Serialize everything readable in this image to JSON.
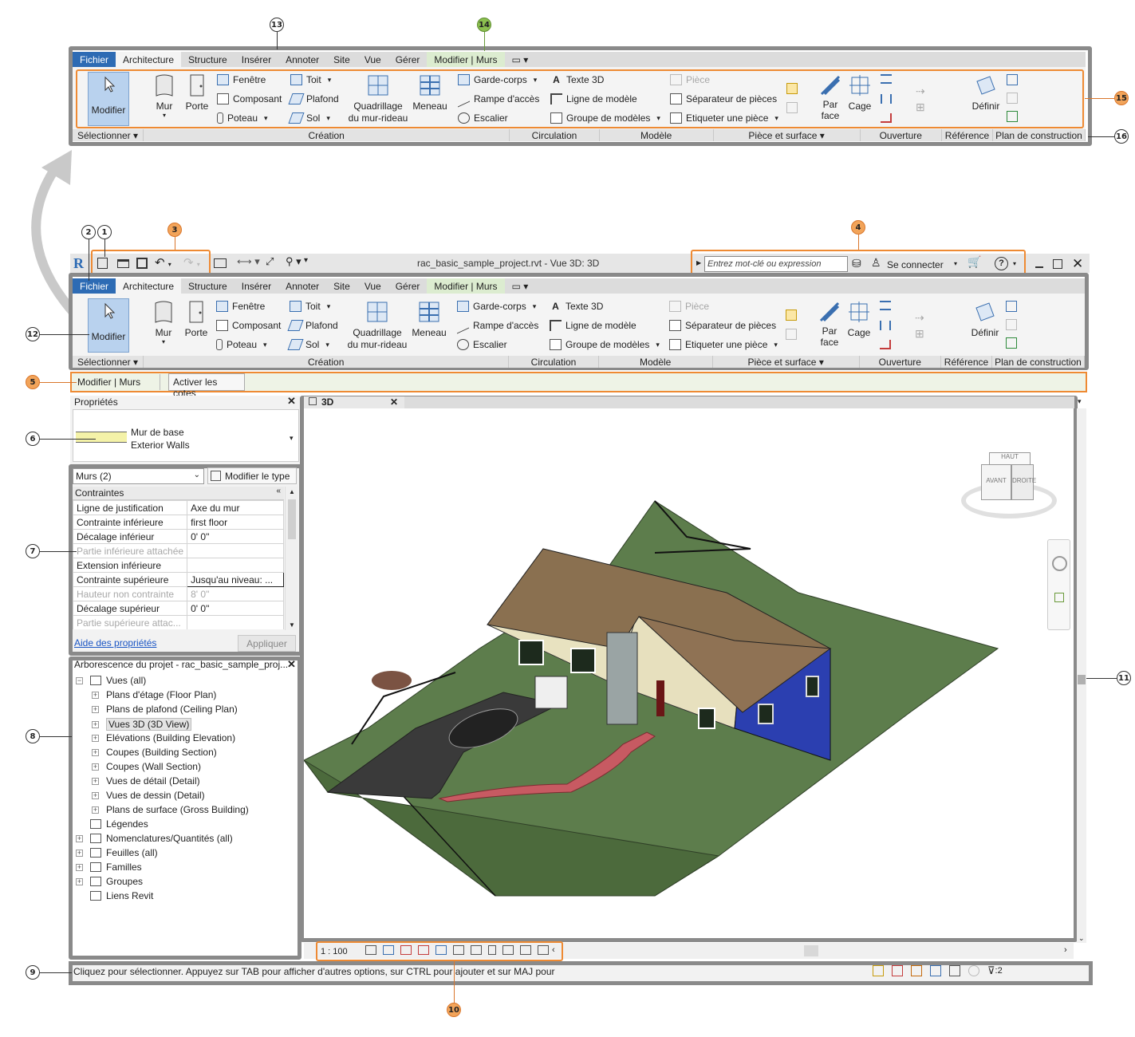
{
  "callouts": [
    "1",
    "2",
    "3",
    "4",
    "5",
    "6",
    "7",
    "8",
    "9",
    "10",
    "11",
    "12",
    "13",
    "14",
    "15",
    "16"
  ],
  "ribbon": {
    "tabs": [
      "Fichier",
      "Architecture",
      "Structure",
      "Insérer",
      "Annoter",
      "Site",
      "Vue",
      "Gérer",
      "Modifier | Murs"
    ],
    "tab_dropdown": "▭ ▾",
    "buttons": {
      "modifier": "Modifier",
      "mur": "Mur",
      "porte": "Porte",
      "fenetre": "Fenêtre",
      "composant": "Composant",
      "poteau": "Poteau",
      "toit": "Toit",
      "plafond": "Plafond",
      "sol": "Sol",
      "quadrillage": "Quadrillage",
      "quadrillage2": "du mur-rideau",
      "meneau": "Meneau",
      "garde_corps": "Garde-corps",
      "rampe": "Rampe d'accès",
      "escalier": "Escalier",
      "texte3d": "Texte 3D",
      "ligne_modele": "Ligne de modèle",
      "groupe_modeles": "Groupe de modèles",
      "piece": "Pièce",
      "separateur": "Séparateur  de pièces",
      "etiqueter": "Etiqueter  une pièce",
      "par": "Par",
      "face": "face",
      "cage": "Cage",
      "definir": "Définir"
    },
    "panels": [
      "Sélectionner ▾",
      "Création",
      "Circulation",
      "Modèle",
      "Pièce et surface ▾",
      "Ouverture",
      "Référence",
      "Plan de construction"
    ]
  },
  "qat": {
    "title": "rac_basic_sample_project.rvt - Vue 3D: 3D",
    "search_placeholder": "Entrez mot-clé ou expression",
    "signin": "Se connecter",
    "help": "?"
  },
  "options_bar": {
    "context": "Modifier | Murs",
    "button": "Activer les cotes"
  },
  "properties": {
    "title": "Propriétés",
    "type_name": "Mur de base",
    "type_sub": "Exterior Walls",
    "filter": "Murs (2)",
    "edit_type": "Modifier le type",
    "group": "Contraintes",
    "rows": [
      {
        "name": "Ligne de justification",
        "value": "Axe du mur",
        "dim": false
      },
      {
        "name": "Contrainte inférieure",
        "value": "first floor",
        "dim": false
      },
      {
        "name": "Décalage inférieur",
        "value": "0'  0\"",
        "dim": false
      },
      {
        "name": "Partie inférieure attachée",
        "value": "",
        "dim": true
      },
      {
        "name": "Extension inférieure",
        "value": "",
        "dim": false
      },
      {
        "name": "Contrainte supérieure",
        "value": "Jusqu'au niveau: ...",
        "dim": false
      },
      {
        "name": "Hauteur non contrainte",
        "value": "8'  0\"",
        "dim": true
      },
      {
        "name": "Décalage supérieur",
        "value": "0'  0\"",
        "dim": false
      },
      {
        "name": "Partie supérieure attac...",
        "value": "",
        "dim": true
      }
    ],
    "help_link": "Aide des propriétés",
    "apply": "Appliquer"
  },
  "browser": {
    "title": "Arborescence du projet - rac_basic_sample_proj...",
    "items": [
      {
        "label": "Vues (all)",
        "level": 0,
        "expand": "−"
      },
      {
        "label": "Plans d'étage (Floor Plan)",
        "level": 1,
        "expand": "+"
      },
      {
        "label": "Plans de plafond (Ceiling Plan)",
        "level": 1,
        "expand": "+"
      },
      {
        "label": "Vues 3D (3D View)",
        "level": 1,
        "expand": "+"
      },
      {
        "label": "Elévations (Building Elevation)",
        "level": 1,
        "expand": "+"
      },
      {
        "label": "Coupes (Building Section)",
        "level": 1,
        "expand": "+"
      },
      {
        "label": "Coupes (Wall Section)",
        "level": 1,
        "expand": "+"
      },
      {
        "label": "Vues de détail (Detail)",
        "level": 1,
        "expand": "+"
      },
      {
        "label": "Vues de dessin (Detail)",
        "level": 1,
        "expand": "+"
      },
      {
        "label": "Plans de surface (Gross Building)",
        "level": 1,
        "expand": "+"
      },
      {
        "label": "Légendes",
        "level": 0,
        "expand": ""
      },
      {
        "label": "Nomenclatures/Quantités (all)",
        "level": 0,
        "expand": "+"
      },
      {
        "label": "Feuilles (all)",
        "level": 0,
        "expand": "+"
      },
      {
        "label": "Familles",
        "level": 0,
        "expand": "+"
      },
      {
        "label": "Groupes",
        "level": 0,
        "expand": "+"
      },
      {
        "label": "Liens Revit",
        "level": 0,
        "expand": ""
      }
    ]
  },
  "viewport": {
    "tab": "3D",
    "scale": "1 : 100",
    "viewcube_top": "HAUT",
    "viewcube_front": "AVANT",
    "viewcube_right": "DROITE"
  },
  "status": {
    "text": "Cliquez pour sélectionner. Appuyez sur TAB pour afficher d'autres options, sur CTRL pour ajouter et sur MAJ pour",
    "filter_count": ":2"
  }
}
